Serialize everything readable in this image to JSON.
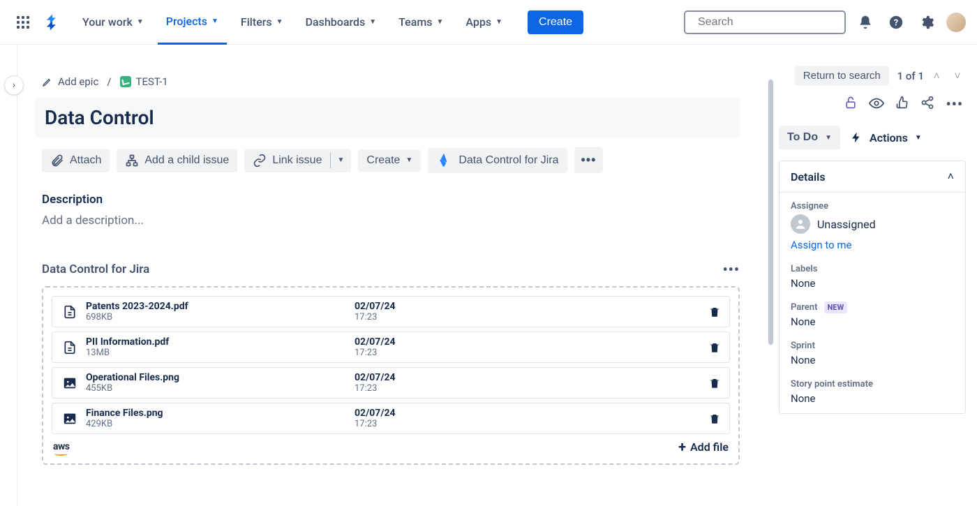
{
  "nav": {
    "your_work": "Your work",
    "projects": "Projects",
    "filters": "Filters",
    "dashboards": "Dashboards",
    "teams": "Teams",
    "apps": "Apps",
    "create": "Create"
  },
  "search": {
    "placeholder": "Search"
  },
  "breadcrumb": {
    "add_epic": "Add epic",
    "issue_key": "TEST-1"
  },
  "issue": {
    "title": "Data Control"
  },
  "actions": {
    "attach": "Attach",
    "add_child": "Add a child issue",
    "link_issue": "Link issue",
    "create": "Create",
    "data_control_app": "Data Control for Jira"
  },
  "description": {
    "heading": "Description",
    "placeholder": "Add a description..."
  },
  "dc_section": {
    "title": "Data Control for Jira",
    "add_file": "Add file",
    "aws": "aws",
    "files": [
      {
        "name": "Patents 2023-2024.pdf",
        "size": "698KB",
        "date": "02/07/24",
        "time": "17:23",
        "type": "pdf"
      },
      {
        "name": "PII Information.pdf",
        "size": "13MB",
        "date": "02/07/24",
        "time": "17:23",
        "type": "pdf"
      },
      {
        "name": "Operational Files.png",
        "size": "455KB",
        "date": "02/07/24",
        "time": "17:23",
        "type": "png"
      },
      {
        "name": "Finance Files.png",
        "size": "429KB",
        "date": "02/07/24",
        "time": "17:23",
        "type": "png"
      }
    ]
  },
  "right": {
    "return": "Return to search",
    "pager": "1 of 1",
    "status": "To Do",
    "actions_label": "Actions",
    "details_title": "Details",
    "assignee_label": "Assignee",
    "assignee_value": "Unassigned",
    "assign_link": "Assign to me",
    "labels_label": "Labels",
    "labels_value": "None",
    "parent_label": "Parent",
    "parent_badge": "NEW",
    "parent_value": "None",
    "sprint_label": "Sprint",
    "sprint_value": "None",
    "sp_label": "Story point estimate",
    "sp_value": "None"
  }
}
